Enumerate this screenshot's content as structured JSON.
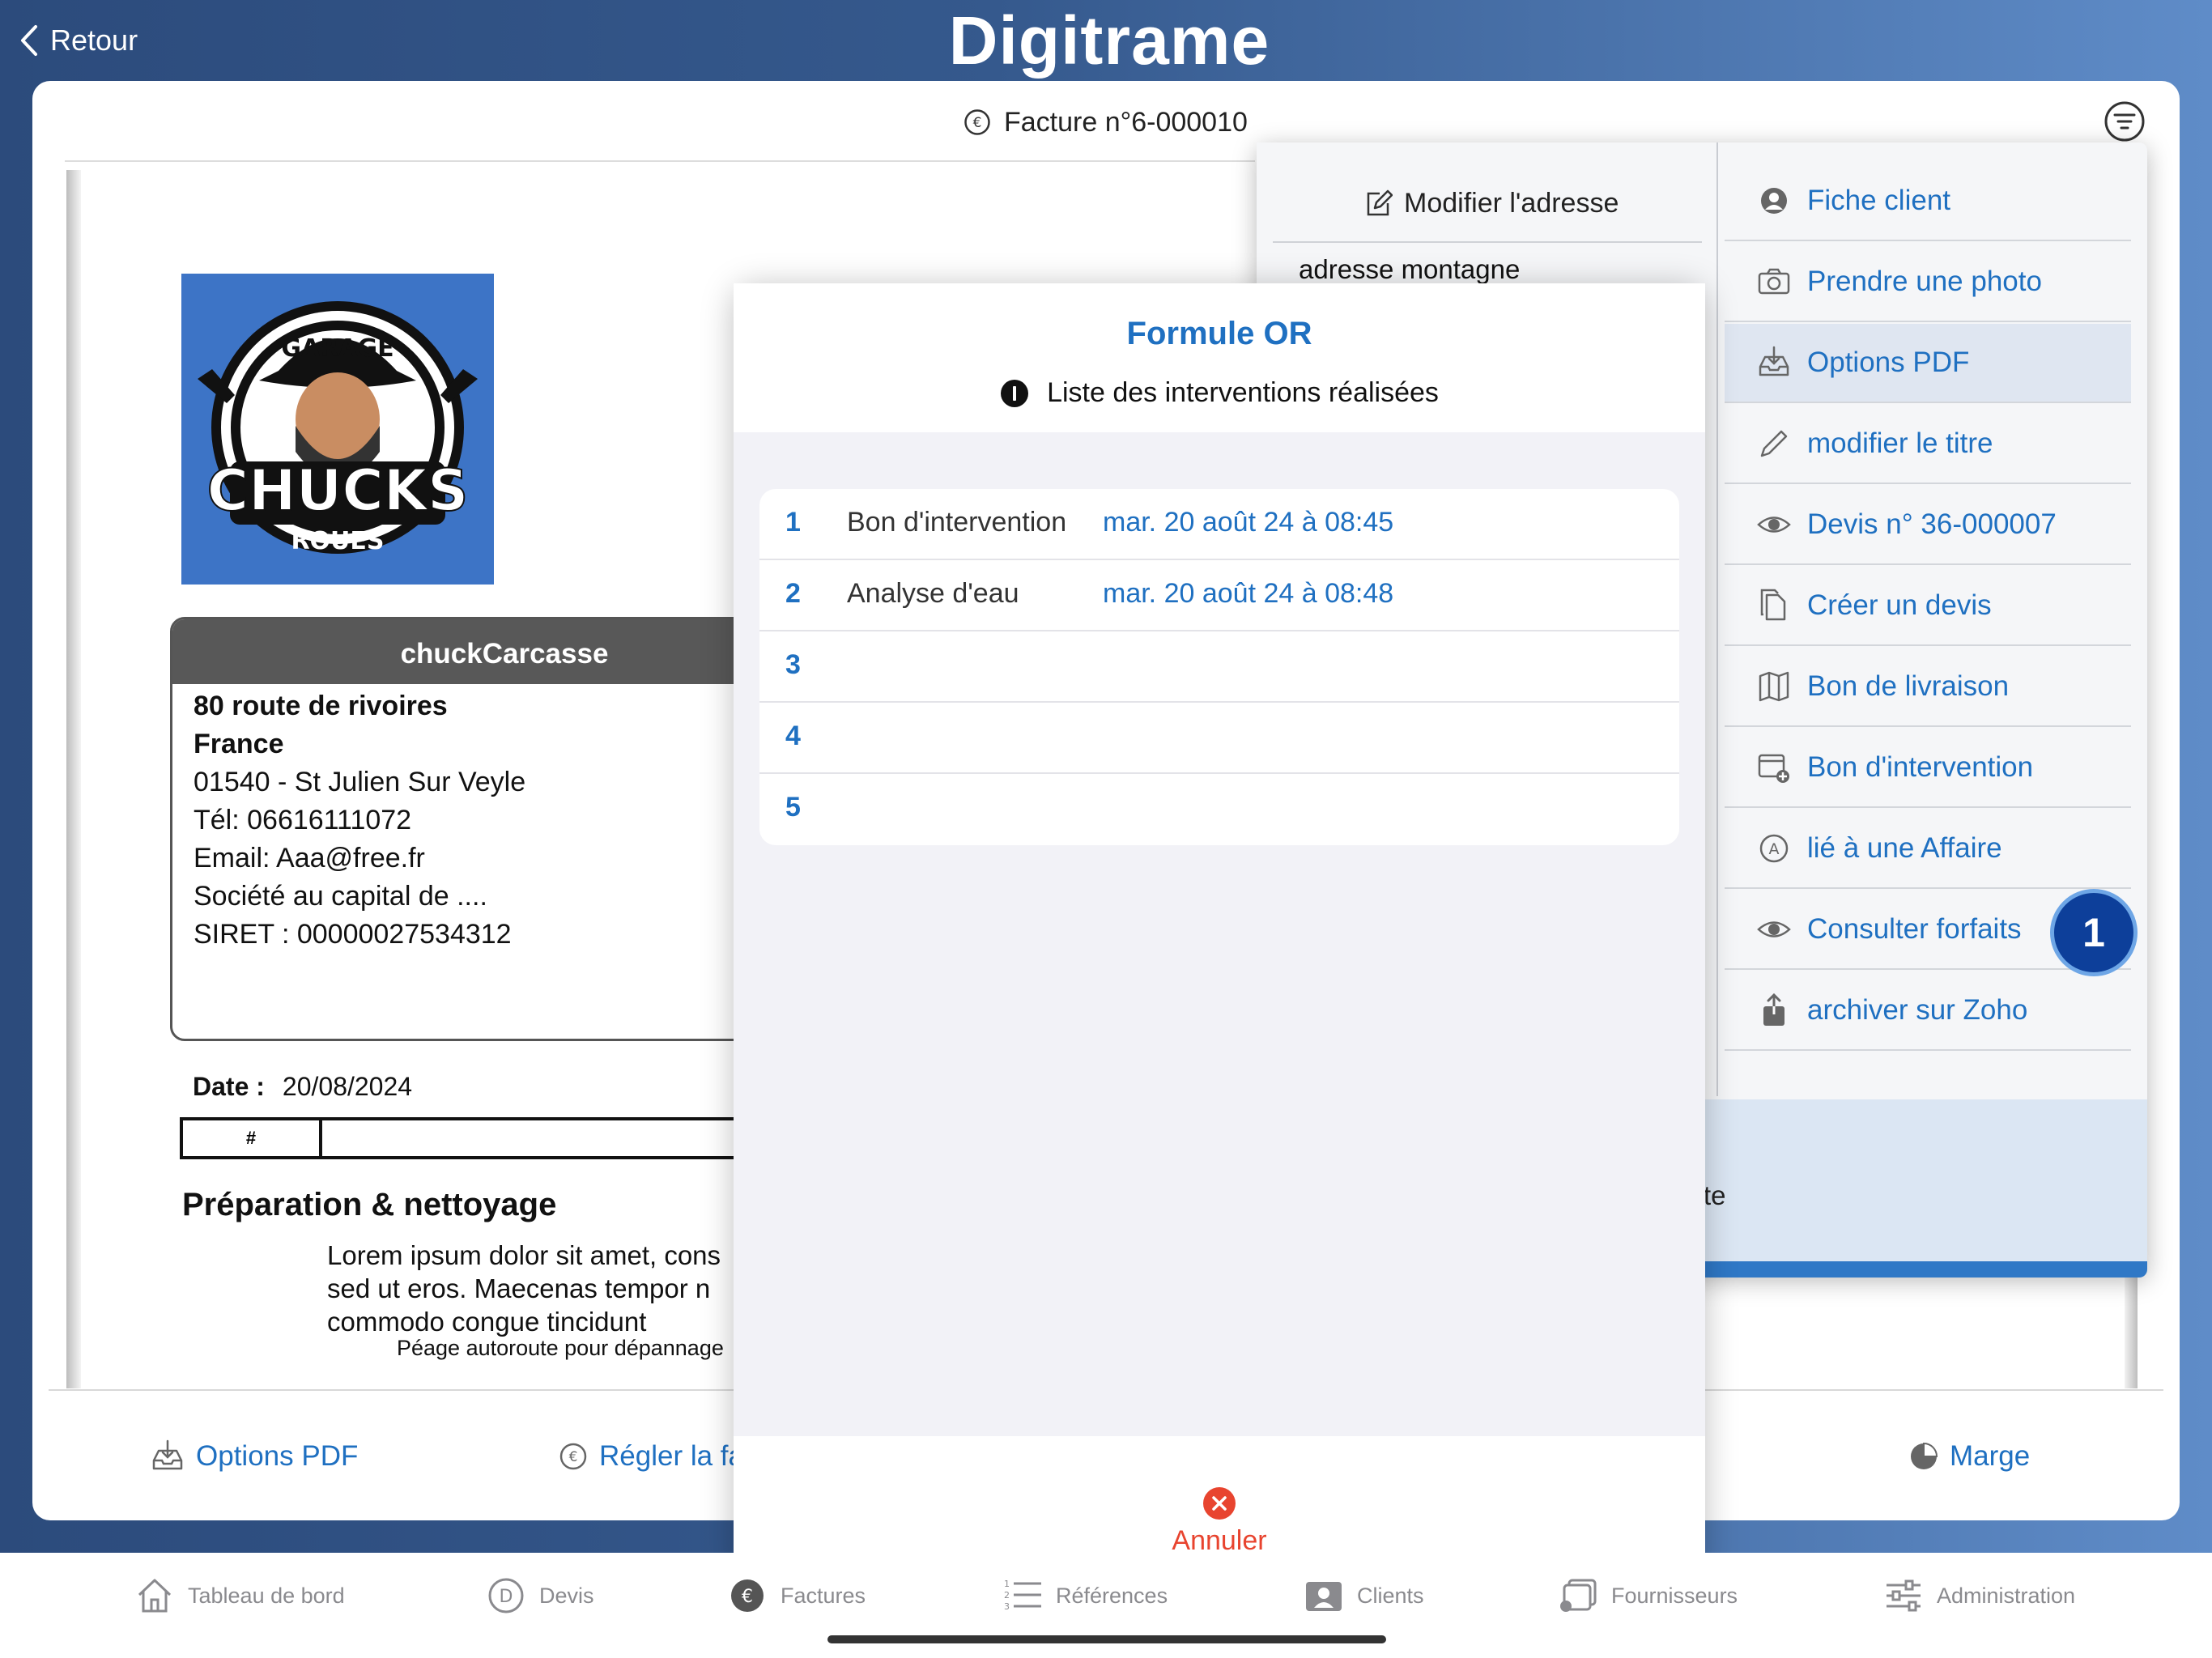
{
  "app": {
    "logo_text": "Digitrame",
    "back_label": "Retour"
  },
  "document": {
    "title": "Facture n°6-000010",
    "logo_text_top": "GARAGE",
    "logo_text_main": "CHUCKS",
    "logo_text_sub": "ROUES",
    "sender_name": "chuckCarcasse",
    "sender_lines": [
      "80 route de rivoires",
      "France",
      "01540 - St Julien Sur Veyle",
      "Tél: 06616111072",
      "Email: Aaa@free.fr",
      "Société au capital de ....",
      "SIRET : 00000027534312"
    ],
    "date_label": "Date :",
    "date_value": "20/08/2024",
    "table_hash": "#",
    "section_title": "Préparation & nettoyage",
    "lorem_lines": [
      "Lorem ipsum dolor sit amet, cons",
      "sed ut eros. Maecenas tempor n",
      "commodo congue tincidunt"
    ],
    "peage_text": "Péage autoroute pour dépannage"
  },
  "card_actions": {
    "options_pdf": "Options PDF",
    "regler": "Régler la fa",
    "marge": "Marge"
  },
  "side_panel": {
    "modify_address": "Modifier l'adresse",
    "address_item": "adresse montagne",
    "bottom_partial": "te",
    "menu": [
      {
        "label": "Fiche client",
        "icon": "person-circle-icon"
      },
      {
        "label": "Prendre une photo",
        "icon": "camera-icon"
      },
      {
        "label": "Options PDF",
        "icon": "tray-download-icon",
        "selected": true
      },
      {
        "label": "modifier le titre",
        "icon": "pencil-icon"
      },
      {
        "label": "Devis n° 36-000007",
        "icon": "eye-icon"
      },
      {
        "label": "Créer un devis",
        "icon": "document-copy-icon"
      },
      {
        "label": "Bon de livraison",
        "icon": "map-icon"
      },
      {
        "label": "Bon d'intervention",
        "icon": "calendar-plus-icon"
      },
      {
        "label": "lié à une Affaire",
        "icon": "circle-a-icon"
      },
      {
        "label": "Consulter forfaits",
        "icon": "eye-icon"
      },
      {
        "label": "archiver sur Zoho",
        "icon": "share-icon"
      }
    ],
    "badge": "1"
  },
  "modal": {
    "title": "Formule OR",
    "subtitle": "Liste des interventions réalisées",
    "rows": [
      {
        "num": "1",
        "label": "Bon d'intervention",
        "date": "mar. 20 août 24 à 08:45"
      },
      {
        "num": "2",
        "label": "Analyse d'eau",
        "date": "mar. 20 août 24 à 08:48"
      },
      {
        "num": "3",
        "label": "",
        "date": ""
      },
      {
        "num": "4",
        "label": "",
        "date": ""
      },
      {
        "num": "5",
        "label": "",
        "date": ""
      }
    ],
    "cancel_label": "Annuler"
  },
  "tabs": [
    {
      "label": "Tableau de bord",
      "icon": "house-icon"
    },
    {
      "label": "Devis",
      "icon": "circle-d-icon"
    },
    {
      "label": "Factures",
      "icon": "euro-circle-icon",
      "active": true
    },
    {
      "label": "Références",
      "icon": "numbered-list-icon"
    },
    {
      "label": "Clients",
      "icon": "person-card-icon"
    },
    {
      "label": "Fournisseurs",
      "icon": "supplier-icon"
    },
    {
      "label": "Administration",
      "icon": "sliders-icon"
    }
  ],
  "colors": {
    "accent": "#1f70c1",
    "danger": "#e8442f",
    "badge": "#0d3f9a"
  }
}
